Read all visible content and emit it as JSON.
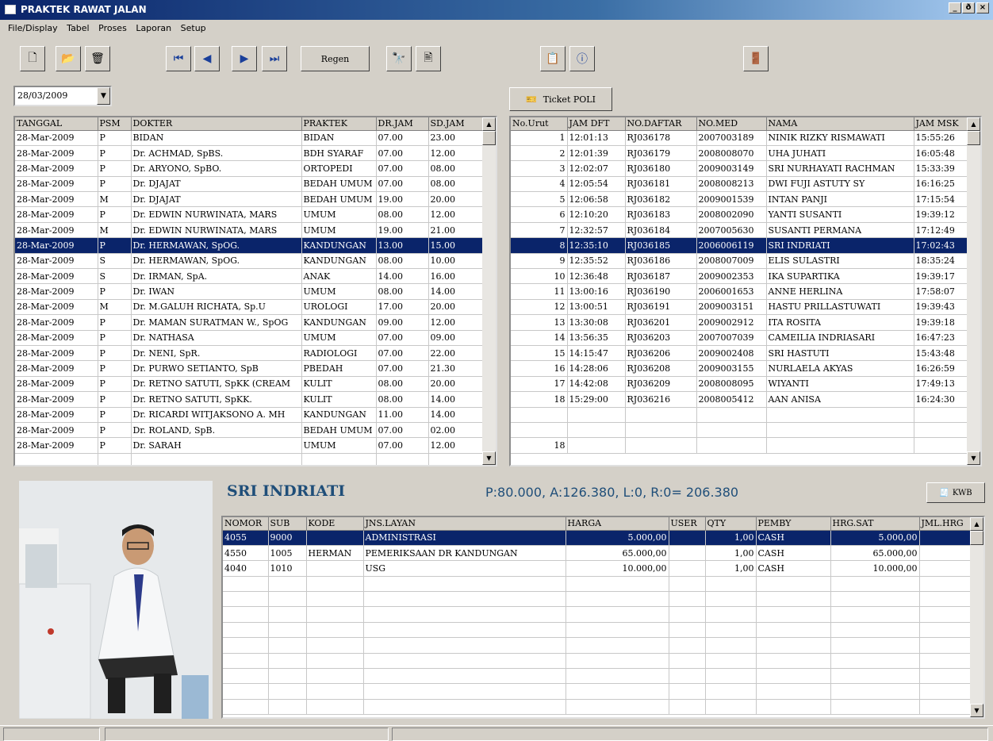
{
  "window": {
    "title": "PRAKTEK RAWAT JALAN",
    "controls": [
      "_",
      "ð",
      "×"
    ]
  },
  "menu": [
    "File/Display",
    "Tabel",
    "Proses",
    "Laporan",
    "Setup"
  ],
  "toolbar": {
    "regen_label": "Regen",
    "ticket_label": "Ticket POLI",
    "kwb_label": "KWB"
  },
  "date": "28/03/2009",
  "doctors": {
    "headers": [
      "TANGGAL",
      "PSM",
      "DOKTER",
      "PRAKTEK",
      "DR.JAM",
      "SD.JAM"
    ],
    "rows": [
      [
        "28-Mar-2009",
        "P",
        "BIDAN",
        "BIDAN",
        "07.00",
        "23.00"
      ],
      [
        "28-Mar-2009",
        "P",
        "Dr. ACHMAD, SpBS.",
        "BDH SYARAF",
        "07.00",
        "12.00"
      ],
      [
        "28-Mar-2009",
        "P",
        "Dr. ARYONO, SpBO.",
        "ORTOPEDI",
        "07.00",
        "08.00"
      ],
      [
        "28-Mar-2009",
        "P",
        "Dr. DJAJAT",
        "BEDAH UMUM",
        "07.00",
        "08.00"
      ],
      [
        "28-Mar-2009",
        "M",
        "Dr. DJAJAT",
        "BEDAH UMUM",
        "19.00",
        "20.00"
      ],
      [
        "28-Mar-2009",
        "P",
        "Dr. EDWIN NURWINATA, MARS",
        "UMUM",
        "08.00",
        "12.00"
      ],
      [
        "28-Mar-2009",
        "M",
        "Dr. EDWIN NURWINATA, MARS",
        "UMUM",
        "19.00",
        "21.00"
      ],
      [
        "28-Mar-2009",
        "P",
        "Dr. HERMAWAN, SpOG.",
        "KANDUNGAN",
        "13.00",
        "15.00"
      ],
      [
        "28-Mar-2009",
        "S",
        "Dr. HERMAWAN, SpOG.",
        "KANDUNGAN",
        "08.00",
        "10.00"
      ],
      [
        "28-Mar-2009",
        "S",
        "Dr. IRMAN, SpA.",
        "ANAK",
        "14.00",
        "16.00"
      ],
      [
        "28-Mar-2009",
        "P",
        "Dr. IWAN",
        "UMUM",
        "08.00",
        "14.00"
      ],
      [
        "28-Mar-2009",
        "M",
        "Dr. M.GALUH RICHATA, Sp.U",
        "UROLOGI",
        "17.00",
        "20.00"
      ],
      [
        "28-Mar-2009",
        "P",
        "Dr. MAMAN SURATMAN W., SpOG",
        "KANDUNGAN",
        "09.00",
        "12.00"
      ],
      [
        "28-Mar-2009",
        "P",
        "Dr. NATHASA",
        "UMUM",
        "07.00",
        "09.00"
      ],
      [
        "28-Mar-2009",
        "P",
        "Dr. NENI, SpR.",
        "RADIOLOGI",
        "07.00",
        "22.00"
      ],
      [
        "28-Mar-2009",
        "P",
        "Dr. PURWO SETIANTO, SpB",
        "PBEDAH",
        "07.00",
        "21.30"
      ],
      [
        "28-Mar-2009",
        "P",
        "Dr. RETNO SATUTI, SpKK (CREAM",
        "KULIT",
        "08.00",
        "20.00"
      ],
      [
        "28-Mar-2009",
        "P",
        "Dr. RETNO SATUTI, SpKK.",
        "KULIT",
        "08.00",
        "14.00"
      ],
      [
        "28-Mar-2009",
        "P",
        "Dr. RICARDI WITJAKSONO A. MH",
        "KANDUNGAN",
        "11.00",
        "14.00"
      ],
      [
        "28-Mar-2009",
        "P",
        "Dr. ROLAND, SpB.",
        "BEDAH UMUM",
        "07.00",
        "02.00"
      ],
      [
        "28-Mar-2009",
        "P",
        "Dr. SARAH",
        "UMUM",
        "07.00",
        "12.00"
      ]
    ],
    "selected": 7
  },
  "patients": {
    "headers": [
      "No.Urut",
      "JAM DFT",
      "NO.DAFTAR",
      "NO.MED",
      "NAMA",
      "JAM MSK"
    ],
    "rows": [
      [
        "1",
        "12:01:13",
        "RJ036178",
        "2007003189",
        "NINIK RIZKY RISMAWATI",
        "15:55:26"
      ],
      [
        "2",
        "12:01:39",
        "RJ036179",
        "2008008070",
        "UHA JUHATI",
        "16:05:48"
      ],
      [
        "3",
        "12:02:07",
        "RJ036180",
        "2009003149",
        "SRI NURHAYATI RACHMAN",
        "15:33:39"
      ],
      [
        "4",
        "12:05:54",
        "RJ036181",
        "2008008213",
        "DWI FUJI ASTUTY SY",
        "16:16:25"
      ],
      [
        "5",
        "12:06:58",
        "RJ036182",
        "2009001539",
        "INTAN PANJI",
        "17:15:54"
      ],
      [
        "6",
        "12:10:20",
        "RJ036183",
        "2008002090",
        "YANTI SUSANTI",
        "19:39:12"
      ],
      [
        "7",
        "12:32:57",
        "RJ036184",
        "2007005630",
        "SUSANTI PERMANA",
        "17:12:49"
      ],
      [
        "8",
        "12:35:10",
        "RJ036185",
        "2006006119",
        "SRI INDRIATI",
        "17:02:43"
      ],
      [
        "9",
        "12:35:52",
        "RJ036186",
        "2008007009",
        "ELIS SULASTRI",
        "18:35:24"
      ],
      [
        "10",
        "12:36:48",
        "RJ036187",
        "2009002353",
        "IKA SUPARTIKA",
        "19:39:17"
      ],
      [
        "11",
        "13:00:16",
        "RJ036190",
        "2006001653",
        "ANNE HERLINA",
        "17:58:07"
      ],
      [
        "12",
        "13:00:51",
        "RJ036191",
        "2009003151",
        "HASTU PRILLASTUWATI",
        "19:39:43"
      ],
      [
        "13",
        "13:30:08",
        "RJ036201",
        "2009002912",
        "ITA ROSITA",
        "19:39:18"
      ],
      [
        "14",
        "13:56:35",
        "RJ036203",
        "2007007039",
        "CAMEILIA INDRIASARI",
        "16:47:23"
      ],
      [
        "15",
        "14:15:47",
        "RJ036206",
        "2009002408",
        "SRI HASTUTI",
        "15:43:48"
      ],
      [
        "16",
        "14:28:06",
        "RJ036208",
        "2009003155",
        "NURLAELA AKYAS",
        "16:26:59"
      ],
      [
        "17",
        "14:42:08",
        "RJ036209",
        "2008008095",
        "WIYANTI",
        "17:49:13"
      ],
      [
        "18",
        "15:29:00",
        "RJ036216",
        "2008005412",
        "AAN ANISA",
        "16:24:30"
      ]
    ],
    "selected": 7,
    "count": "18"
  },
  "patient_name": "SRI INDRIATI",
  "totals": "P:80.000, A:126.380, L:0, R:0= 206.380",
  "services": {
    "headers": [
      "NOMOR",
      "SUB",
      "KODE",
      "JNS.LAYAN",
      "HARGA",
      "USER",
      "QTY",
      "PEMBY",
      "HRG.SAT",
      "JML.HRG"
    ],
    "rows": [
      [
        "4055",
        "9000",
        "",
        "ADMINISTRASI",
        "5.000,00",
        "",
        "1,00",
        "CASH",
        "5.000,00",
        ""
      ],
      [
        "4550",
        "1005",
        "HERMAN",
        "PEMERIKSAAN DR KANDUNGAN",
        "65.000,00",
        "",
        "1,00",
        "CASH",
        "65.000,00",
        ""
      ],
      [
        "4040",
        "1010",
        "",
        "USG",
        "10.000,00",
        "",
        "1,00",
        "CASH",
        "10.000,00",
        ""
      ]
    ],
    "selected": 0
  },
  "colors": {
    "selection": "#0a246a",
    "accent": "#1f4e79"
  }
}
